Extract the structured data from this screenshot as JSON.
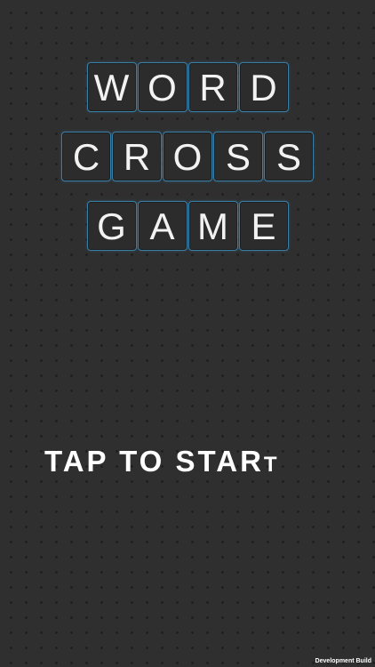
{
  "title": {
    "rows": [
      [
        "W",
        "O",
        "R",
        "D"
      ],
      [
        "C",
        "R",
        "O",
        "S",
        "S"
      ],
      [
        "G",
        "A",
        "M",
        "E"
      ]
    ]
  },
  "start": {
    "label_main": "TAP TO STAR",
    "label_last": "T"
  },
  "footer": {
    "build_label": "Development Build"
  },
  "colors": {
    "background": "#2f2f2f",
    "tile_border": "#3a7fa6",
    "tile_text": "#f2f2f2"
  }
}
